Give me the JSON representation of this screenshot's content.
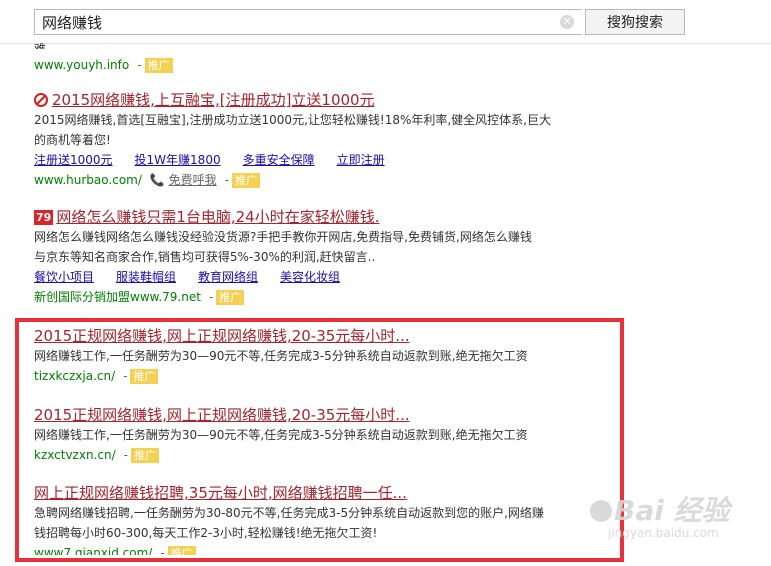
{
  "search": {
    "query": "网络赚钱",
    "button_label": "搜狗搜索"
  },
  "top_clipped": {
    "desc_fragment": "难",
    "url": "www.youyh.info",
    "promo": "推广"
  },
  "results": [
    {
      "title": "2015网络赚钱,上互融宝,[注册成功]立送1000元",
      "desc1": "2015网络赚钱,首选[互融宝],注册成功立送1000元,让您轻松赚钱!18%年利率,健全风控体系,巨大",
      "desc2": "的商机等着您!",
      "links": [
        "注册送1000元",
        "投1W年赚1800",
        "多重安全保障",
        "立即注册"
      ],
      "url": "www.hurbao.com/",
      "phone": "免费呼我",
      "promo": "推广"
    },
    {
      "logo": "79",
      "title": "网络怎么赚钱只需1台电脑,24小时在家轻松赚钱.",
      "desc1": "网络怎么赚钱网络怎么赚钱没经验没货源?手把手教你开网店,免费指导,免费铺货,网络怎么赚钱",
      "desc2": "与京东等知名商家合作,销售均可获得5%-30%的利润,赶快留言..",
      "links": [
        "餐饮小项目",
        "服装鞋帽组",
        "教育网络组",
        "美容化妆组"
      ],
      "url": "新创国际分销加盟www.79.net",
      "promo": "推广"
    },
    {
      "title": "2015正规网络赚钱,网上正规网络赚钱,20-35元每小时...",
      "desc1": "网络赚钱工作,一任务酬劳为30—90元不等,任务完成3-5分钟系统自动返款到账,绝无拖欠工资",
      "url": "tizxkczxja.cn/",
      "promo": "推广"
    },
    {
      "title": "2015正规网络赚钱,网上正规网络赚钱,20-35元每小时...",
      "desc1": "网络赚钱工作,一任务酬劳为30—90元不等,任务完成3-5分钟系统自动返款到账,绝无拖欠工资",
      "url": "kzxctvzxn.cn/",
      "promo": "推广"
    },
    {
      "title": "网上正规网络赚钱招聘,35元每小时,网络赚钱招聘一任...",
      "desc1": "急聘网络赚钱招聘,一任务酬劳为30-80元不等,任务完成3-5分钟系统自动返款到您的账户,网络赚",
      "desc2": "钱招聘每小时60-300,每天工作2-3小时,轻松赚钱!绝无拖欠工资!",
      "url": "www7.qianxid.com/",
      "promo": "推广"
    }
  ],
  "watermark": {
    "main": "Bai 经验",
    "sub": "jingyan.baidu.com"
  }
}
